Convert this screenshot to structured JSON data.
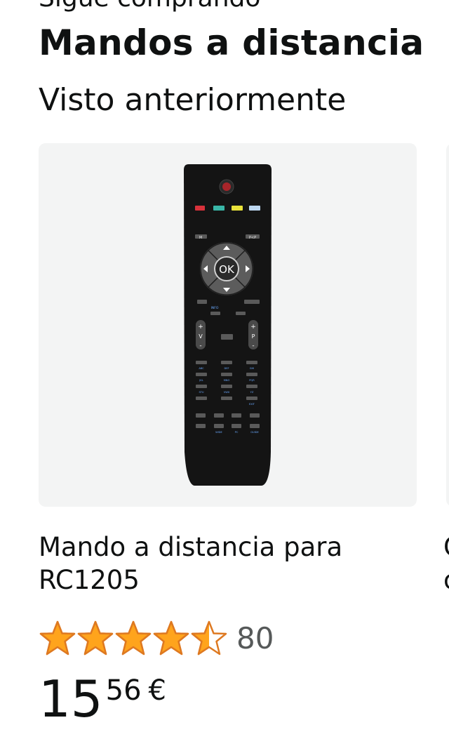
{
  "section": {
    "kicker": "Sigue comprando",
    "title": "Mandos a distancia",
    "subtitle": "Visto anteriormente"
  },
  "product": {
    "title": "Mando a distancia para RC1205",
    "rating_value": 4.5,
    "rating_max": 5,
    "rating_count": "80",
    "price_whole": "15",
    "price_fraction": "56",
    "price_symbol": "€",
    "image_icon": "tv-remote-control-icon"
  },
  "peek_card": {
    "title_line1": "C",
    "title_line2": "c"
  },
  "remote_labels": {
    "ok": "OK",
    "m": "M",
    "pip": "P<P",
    "info": "INFO",
    "v": "V",
    "p": "P",
    "exit": "EXIT",
    "wide": "WIDE",
    "pc": "PC",
    "guide": "GUIDE"
  },
  "colors": {
    "star": "#ffa41c",
    "star_outline": "#de7921",
    "card_bg": "#f3f4f4",
    "text": "#0f1111",
    "muted": "#565959"
  }
}
